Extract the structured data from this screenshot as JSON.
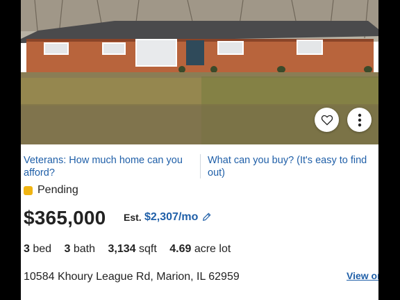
{
  "listing": {
    "promo_left": "Veterans: How much home can you afford?",
    "promo_right": "What can you buy? (It's easy to find out)",
    "status": "Pending",
    "status_color": "#f0b412",
    "price": "$365,000",
    "est_label": "Est.",
    "est_payment": "$2,307/mo",
    "beds_value": "3",
    "beds_label": "bed",
    "baths_value": "3",
    "baths_label": "bath",
    "sqft_value": "3,134",
    "sqft_label": "sqft",
    "lot_value": "4.69",
    "lot_label": "acre lot",
    "address": "10584 Khoury League Rd, Marion, IL 62959",
    "view_link": "View or"
  },
  "icons": {
    "favorite": "heart-icon",
    "more": "more-vertical-icon",
    "edit": "pencil-icon"
  },
  "colors": {
    "link": "#1f5fa8",
    "text": "#222222"
  }
}
